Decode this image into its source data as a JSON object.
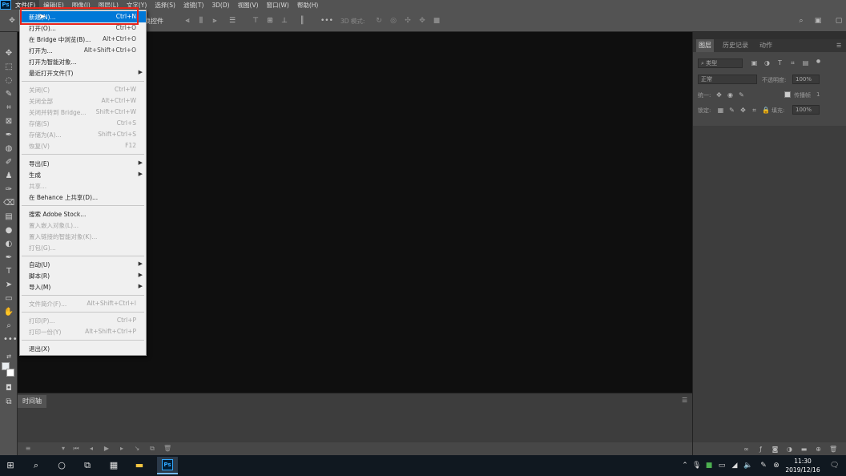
{
  "menubar": {
    "items": [
      "文件(F)",
      "编辑(E)",
      "图像(I)",
      "图层(L)",
      "文字(Y)",
      "选择(S)",
      "滤镜(T)",
      "3D(D)",
      "视图(V)",
      "窗口(W)",
      "帮助(H)"
    ]
  },
  "optbar": {
    "transform_label": "换控件",
    "mode3d_label": "3D 模式:"
  },
  "file_menu": {
    "items": [
      {
        "label": "新建(N)...",
        "shortcut": "Ctrl+N",
        "state": "highlighted"
      },
      {
        "label": "打开(O)...",
        "shortcut": "Ctrl+O"
      },
      {
        "label": "在 Bridge 中浏览(B)...",
        "shortcut": "Alt+Ctrl+O"
      },
      {
        "label": "打开为...",
        "shortcut": "Alt+Shift+Ctrl+O"
      },
      {
        "label": "打开为智能对象..."
      },
      {
        "label": "最近打开文件(T)",
        "submenu": true
      },
      {
        "label": "关闭(C)",
        "shortcut": "Ctrl+W",
        "disabled": true
      },
      {
        "label": "关闭全部",
        "shortcut": "Alt+Ctrl+W",
        "disabled": true
      },
      {
        "label": "关闭并转到 Bridge...",
        "shortcut": "Shift+Ctrl+W",
        "disabled": true
      },
      {
        "label": "存储(S)",
        "shortcut": "Ctrl+S",
        "disabled": true
      },
      {
        "label": "存储为(A)...",
        "shortcut": "Shift+Ctrl+S",
        "disabled": true
      },
      {
        "label": "恢复(V)",
        "shortcut": "F12",
        "disabled": true
      },
      {
        "label": "导出(E)",
        "submenu": true
      },
      {
        "label": "生成",
        "submenu": true
      },
      {
        "label": "共享...",
        "disabled": true
      },
      {
        "label": "在 Behance 上共享(D)..."
      },
      {
        "label": "搜索 Adobe Stock..."
      },
      {
        "label": "置入嵌入对象(L)...",
        "disabled": true
      },
      {
        "label": "置入链接的智能对象(K)...",
        "disabled": true
      },
      {
        "label": "打包(G)...",
        "disabled": true
      },
      {
        "label": "自动(U)",
        "submenu": true
      },
      {
        "label": "脚本(R)",
        "submenu": true
      },
      {
        "label": "导入(M)",
        "submenu": true
      },
      {
        "label": "文件简介(F)...",
        "shortcut": "Alt+Shift+Ctrl+I",
        "disabled": true
      },
      {
        "label": "打印(P)...",
        "shortcut": "Ctrl+P",
        "disabled": true
      },
      {
        "label": "打印一份(Y)",
        "shortcut": "Alt+Shift+Ctrl+P",
        "disabled": true
      },
      {
        "label": "退出(X)",
        "shortcut": ""
      }
    ]
  },
  "right_panel": {
    "tabs": [
      "图层",
      "历史记录",
      "动作"
    ],
    "kind_filter": "类型",
    "blend_mode": "正常",
    "opacity_label": "不透明度:",
    "opacity_value": "100%",
    "unify_label": "统一:",
    "propagate_label": "传播帧",
    "propagate_value": "1",
    "lock_label": "锁定:",
    "fill_label": "填充:",
    "fill_value": "100%"
  },
  "timeline": {
    "tab_label": "时间轴"
  },
  "taskbar": {
    "time": "11:30",
    "date": "2019/12/16"
  },
  "colors": {
    "highlight_box": "#e8231a",
    "menu_highlight": "#0078d7",
    "canvas": "#0f0f0f"
  }
}
